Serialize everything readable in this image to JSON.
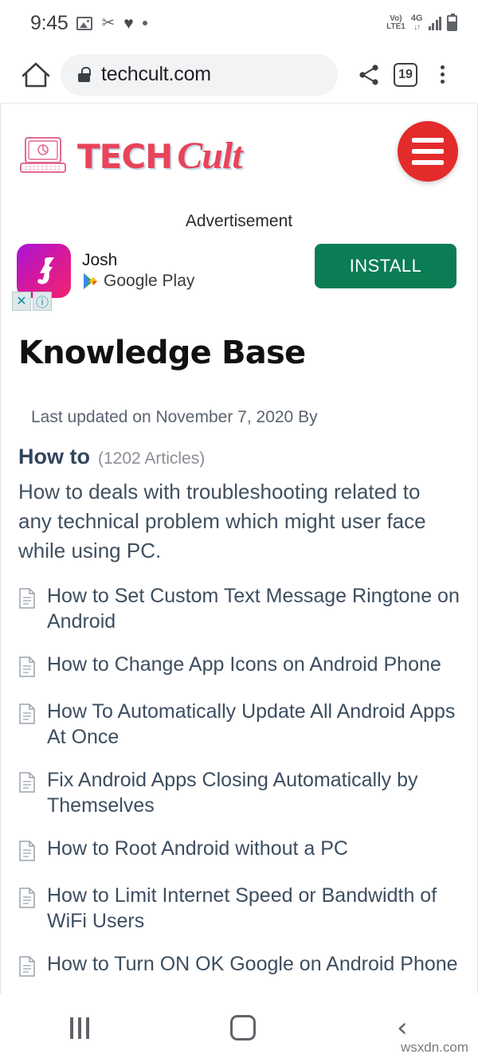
{
  "status_bar": {
    "time": "9:45",
    "left_icons": [
      "image-icon",
      "scissors-icon",
      "heart-icon",
      "dot-icon"
    ],
    "carrier_volte": "Vo)",
    "carrier_lte": "LTE1",
    "network": "4G",
    "data_arrows": "↓↑",
    "signal": "signal-bars-icon",
    "battery": "battery-icon"
  },
  "browser": {
    "home_icon": "home-icon",
    "lock_icon": "lock-icon",
    "url": "techcult.com",
    "share_icon": "share-icon",
    "tab_count": "19",
    "menu_icon": "overflow-menu-icon"
  },
  "site": {
    "logo_icon": "laptop-icon",
    "brand_first": "TECH",
    "brand_second": "Cult",
    "menu_button": "hamburger-menu-icon",
    "brand_color": "#e8445a",
    "menu_color": "#e32b2b"
  },
  "ad": {
    "label": "Advertisement",
    "app_icon": "josh-app-icon",
    "app_name": "Josh",
    "store_icon": "google-play-icon",
    "store_name": "Google Play",
    "install_label": "INSTALL",
    "install_color": "#0b7d55",
    "close_badge": "✕",
    "info_badge": "ⓘ"
  },
  "article": {
    "title": "Knowledge Base",
    "meta": "Last updated on November 7, 2020 By",
    "category": "How to",
    "category_count": "(1202 Articles)",
    "description": "How to deals with troubleshooting related to any technical problem which might user face while using PC.",
    "items": [
      {
        "icon": "document-icon",
        "label": "How to Set Custom Text Message Ringtone on Android"
      },
      {
        "icon": "document-icon",
        "label": "How to Change App Icons on Android Phone"
      },
      {
        "icon": "document-icon",
        "label": "How To Automatically Update All Android Apps At Once"
      },
      {
        "icon": "document-icon",
        "label": "Fix Android Apps Closing Automatically by Themselves"
      },
      {
        "icon": "document-icon",
        "label": "How to Root Android without a PC"
      },
      {
        "icon": "document-icon",
        "label": "How to Limit Internet Speed or Bandwidth of WiFi Users"
      },
      {
        "icon": "document-icon",
        "label": "How to Turn ON OK Google on Android Phone"
      }
    ]
  },
  "nav_bar": {
    "recents": "recents-icon",
    "home": "home-square-icon",
    "back": "‹",
    "watermark": "wsxdn.com"
  }
}
